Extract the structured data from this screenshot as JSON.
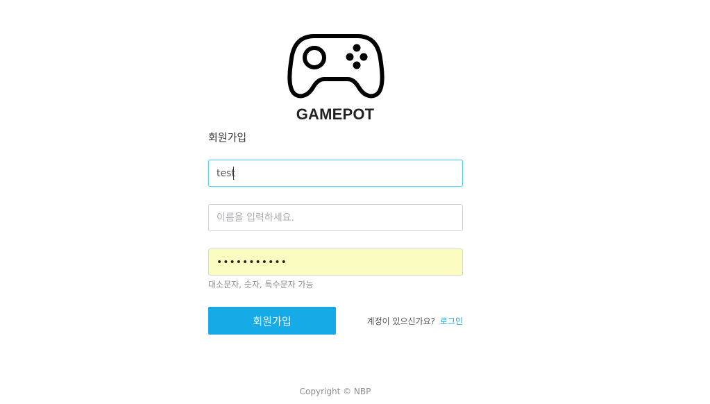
{
  "brand": {
    "logo_icon": "gamepad-icon",
    "name": "GAMEPOT"
  },
  "form": {
    "title": "회원가입",
    "id_value": "test",
    "name_placeholder": "이름을 입력하세요.",
    "password_masked": "•••••••••••",
    "password_hint": "대소문자, 숫자, 특수문자 가능",
    "submit_label": "회원가입",
    "login_prompt": "계정이 있으신가요?",
    "login_link": "로그인"
  },
  "footer": {
    "copyright": "Copyright © NBP"
  },
  "colors": {
    "accent": "#16aae7",
    "focus_border": "#5ecdf3",
    "autofill_bg": "#fafdbf"
  }
}
